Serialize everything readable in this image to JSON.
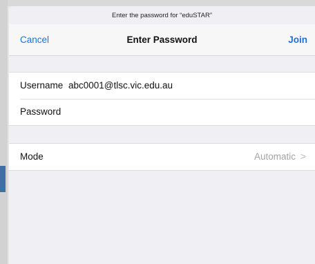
{
  "prompt": "Enter the password for “eduSTAR”",
  "nav": {
    "cancel_label": "Cancel",
    "title": "Enter Password",
    "join_label": "Join"
  },
  "credentials": {
    "username_label": "Username",
    "username_value": "abc0001@tlsc.vic.edu.au",
    "password_label": "Password",
    "password_value": ""
  },
  "mode": {
    "label": "Mode",
    "value": "Automatic",
    "chevron": ">"
  },
  "colors": {
    "accent": "#1a73d9",
    "background": "#efeff4",
    "detail_text": "#a3a3a8"
  },
  "icons": {
    "disclosure": "chevron-right-icon"
  }
}
